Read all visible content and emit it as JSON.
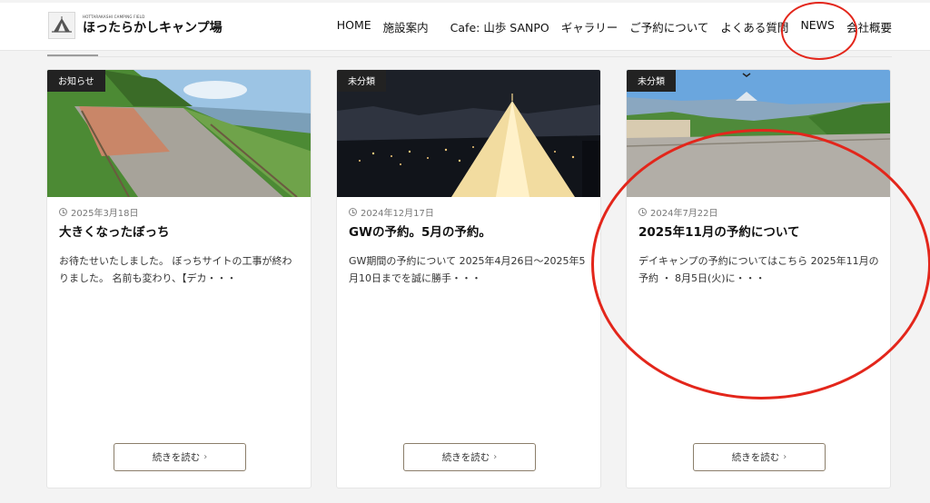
{
  "header": {
    "logo_sub": "HOTTARAKASHI CAMPING FIELD",
    "logo_name": "ほったらかしキャンプ場",
    "nav": [
      "HOME",
      "施設案内",
      "Cafe: 山歩 SANPO",
      "ギャラリー",
      "ご予約について",
      "よくある質問",
      "NEWS",
      "会社概要"
    ]
  },
  "cards": [
    {
      "category": "お知らせ",
      "date": "2025年3月18日",
      "title": "大きくなったぼっち",
      "excerpt": "お待たせいたしました。 ぼっちサイトの工事が終わりました。 名前も変わり、【デカ・・・",
      "read_more": "続きを読む"
    },
    {
      "category": "未分類",
      "date": "2024年12月17日",
      "title": "GWの予約。5月の予約。",
      "excerpt": "GW期間の予約について 2025年4月26日〜2025年5月10日までを誠に勝手・・・",
      "read_more": "続きを読む"
    },
    {
      "category": "未分類",
      "date": "2024年7月22日",
      "title": "2025年11月の予約について",
      "excerpt": "デイキャンプの予約についてはこちら 2025年11月の予約 ・ 8月5日(火)に・・・",
      "read_more": "続きを読む"
    }
  ],
  "colors": {
    "annotation": "#e3261b",
    "category_bg": "#222222",
    "button_border": "#8b7e6a"
  },
  "icons": {
    "date": "clock-icon",
    "read_more": "chevron-right-icon"
  }
}
